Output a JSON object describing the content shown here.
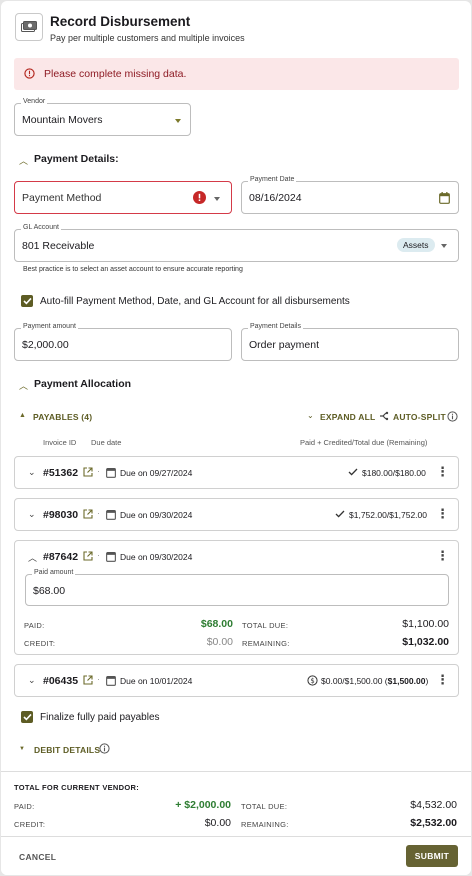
{
  "header": {
    "title": "Record Disbursement",
    "subtitle": "Pay per multiple customers and multiple invoices"
  },
  "alert": {
    "text": "Please complete missing data."
  },
  "vendor": {
    "label": "Vendor",
    "value": "Mountain Movers"
  },
  "payment_details": {
    "section_title": "Payment Details:",
    "method_placeholder": "Payment Method",
    "date_label": "Payment Date",
    "date_value": "08/16/2024",
    "gl_label": "GL Account",
    "gl_value": "801 Receivable",
    "gl_badge": "Assets",
    "gl_hint": "Best practice is to select an asset account to ensure accurate reporting",
    "autofill_label": "Auto-fill Payment Method, Date, and GL Account for all disbursements",
    "amount_label": "Payment amount",
    "amount_value": "$2,000.00",
    "details_label": "Payment Details",
    "details_value": "Order payment"
  },
  "allocation": {
    "section_title": "Payment Allocation",
    "payables_label": "PAYABLES (4)",
    "expand_all": "EXPAND ALL",
    "auto_split": "AUTO-SPLIT",
    "col_invoice": "Invoice ID",
    "col_due": "Due date",
    "col_amount": "Paid + Credited/Total due (Remaining)",
    "invoices": [
      {
        "id": "#51362",
        "due": "Due on 09/27/2024",
        "amount": "$180.00/$180.00"
      },
      {
        "id": "#98030",
        "due": "Due on 09/30/2024",
        "amount": "$1,752.00/$1,752.00"
      },
      {
        "id": "#87642",
        "due": "Due on 09/30/2024",
        "paid_amount_label": "Paid amount",
        "paid_amount_value": "$68.00",
        "paid_label": "PAID:",
        "paid_value": "$68.00",
        "credit_label": "CREDIT:",
        "credit_value": "$0.00",
        "total_due_label": "TOTAL DUE:",
        "total_due_value": "$1,100.00",
        "remaining_label": "REMAINING:",
        "remaining_value": "$1,032.00"
      },
      {
        "id": "#06435",
        "due": "Due on 10/01/2024",
        "amount": "$0.00/$1,500.00 (",
        "amount_bold": "$1,500.00",
        "amount_close": ")"
      }
    ],
    "finalize_label": "Finalize fully paid payables",
    "debit_details": "DEBIT DETAILS"
  },
  "footer": {
    "title": "TOTAL FOR CURRENT VENDOR:",
    "paid_label": "PAID:",
    "paid_value": "+ $2,000.00",
    "credit_label": "CREDIT:",
    "credit_value": "$0.00",
    "total_due_label": "TOTAL DUE:",
    "total_due_value": "$4,532.00",
    "remaining_label": "REMAINING:",
    "remaining_value": "$2,532.00",
    "cancel": "CANCEL",
    "submit": "SUBMIT"
  },
  "colors": {
    "accent": "#666333",
    "error": "#d43a48",
    "alert_bg": "#fbe7e8",
    "positive": "#2e7d32"
  },
  "icons": [
    "cash-icon",
    "error-circle-icon",
    "chevron-down-icon",
    "chevron-up-icon",
    "calendar-icon",
    "info-icon",
    "split-icon",
    "check-icon",
    "open-external-icon",
    "more-vert-icon",
    "dollar-circle-icon"
  ]
}
